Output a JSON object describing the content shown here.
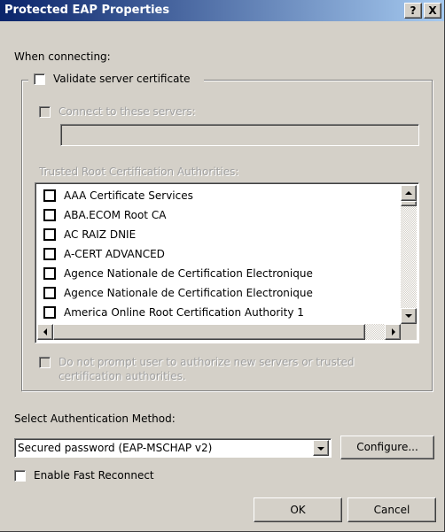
{
  "window": {
    "title": "Protected EAP Properties",
    "help_button": "?",
    "close_button": "X"
  },
  "when_connecting_label": "When connecting:",
  "validate_server_cert": {
    "label": "Validate server certificate",
    "checked": false
  },
  "connect_to_servers": {
    "label": "Connect to these servers:",
    "checked": false,
    "enabled": false,
    "value": ""
  },
  "trusted_root_label": "Trusted Root Certification Authorities:",
  "trusted_roots": [
    {
      "label": "AAA Certificate Services",
      "checked": false
    },
    {
      "label": "ABA.ECOM Root CA",
      "checked": false
    },
    {
      "label": "AC RAIZ DNIE",
      "checked": false
    },
    {
      "label": "A-CERT ADVANCED",
      "checked": false
    },
    {
      "label": "Agence Nationale de Certification Electronique",
      "checked": false
    },
    {
      "label": "Agence Nationale de Certification Electronique",
      "checked": false
    },
    {
      "label": "America Online Root Certification Authority 1",
      "checked": false
    }
  ],
  "do_not_prompt": {
    "line1": "Do not prompt user to authorize new servers or trusted",
    "line2": "certification authorities.",
    "checked": false,
    "enabled": false
  },
  "auth_method_label": "Select Authentication Method:",
  "auth_method_value": "Secured password (EAP-MSCHAP v2)",
  "configure_label": "Configure...",
  "fast_reconnect": {
    "label": "Enable Fast Reconnect",
    "checked": false
  },
  "ok_label": "OK",
  "cancel_label": "Cancel"
}
